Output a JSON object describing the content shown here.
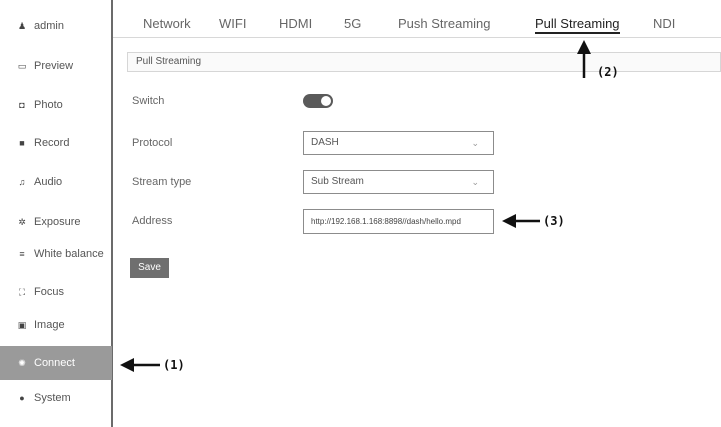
{
  "sidebar": {
    "items": [
      {
        "label": "admin",
        "icon": "user-icon",
        "glyph": "♟"
      },
      {
        "label": "Preview",
        "icon": "preview-icon",
        "glyph": "▭"
      },
      {
        "label": "Photo",
        "icon": "camera-icon",
        "glyph": "◘"
      },
      {
        "label": "Record",
        "icon": "record-icon",
        "glyph": "■"
      },
      {
        "label": "Audio",
        "icon": "audio-icon",
        "glyph": "♫"
      },
      {
        "label": "Exposure",
        "icon": "exposure-icon",
        "glyph": "✲"
      },
      {
        "label": "White balance",
        "icon": "white-balance-icon",
        "glyph": "≡"
      },
      {
        "label": "Focus",
        "icon": "focus-icon",
        "glyph": "⛶"
      },
      {
        "label": "Image",
        "icon": "image-icon",
        "glyph": "▣"
      },
      {
        "label": "Connect",
        "icon": "connect-icon",
        "glyph": "✺"
      },
      {
        "label": "System",
        "icon": "system-icon",
        "glyph": "●"
      }
    ],
    "active": "Connect"
  },
  "tabs": [
    "Network",
    "WIFI",
    "HDMI",
    "5G",
    "Push Streaming",
    "Pull Streaming",
    "NDI"
  ],
  "active_tab": "Pull Streaming",
  "section_title": "Pull Streaming",
  "form": {
    "switch_label": "Switch",
    "switch_on": true,
    "protocol_label": "Protocol",
    "protocol_value": "DASH",
    "stream_type_label": "Stream type",
    "stream_type_value": "Sub Stream",
    "address_label": "Address",
    "address_value": "http://192.168.1.168:8898//dash/hello.mpd",
    "save_label": "Save"
  },
  "annotations": {
    "a1": "(1)",
    "a2": "(2)",
    "a3": "(3)"
  },
  "colors": {
    "active_sidebar": "#9a9a9a",
    "toggle_on": "#5a5a5a",
    "save_button": "#6f6f6f"
  }
}
